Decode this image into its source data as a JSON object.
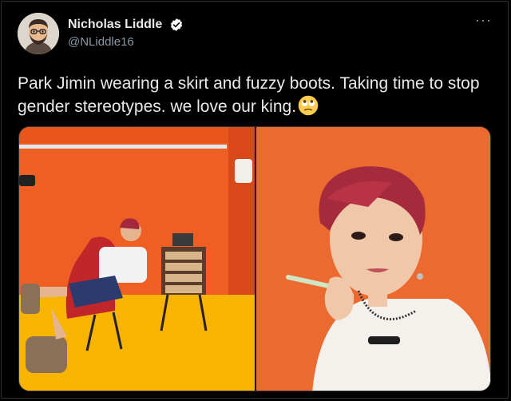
{
  "author": {
    "display_name": "Nicholas Liddle",
    "handle": "@NLiddle16",
    "verified": true,
    "avatar_icon": "cartoon-avatar-icon"
  },
  "menu": {
    "more_label": "···"
  },
  "tweet": {
    "text": "Park Jimin wearing a skirt and fuzzy boots. Taking time to stop gender stereotypes. we love our king.",
    "emoji": "face-with-rolling-eyes-icon"
  },
  "media": {
    "count": 2,
    "images": [
      {
        "icon": "photo-icon"
      },
      {
        "icon": "photo-icon"
      }
    ]
  },
  "colors": {
    "background": "#000000",
    "text": "#e7e9ea",
    "secondary_text": "#8b98a5",
    "verified_badge": "#ffffff",
    "photo_left_bg": "#ef5f24",
    "photo_right_bg": "#ec6a2f"
  }
}
